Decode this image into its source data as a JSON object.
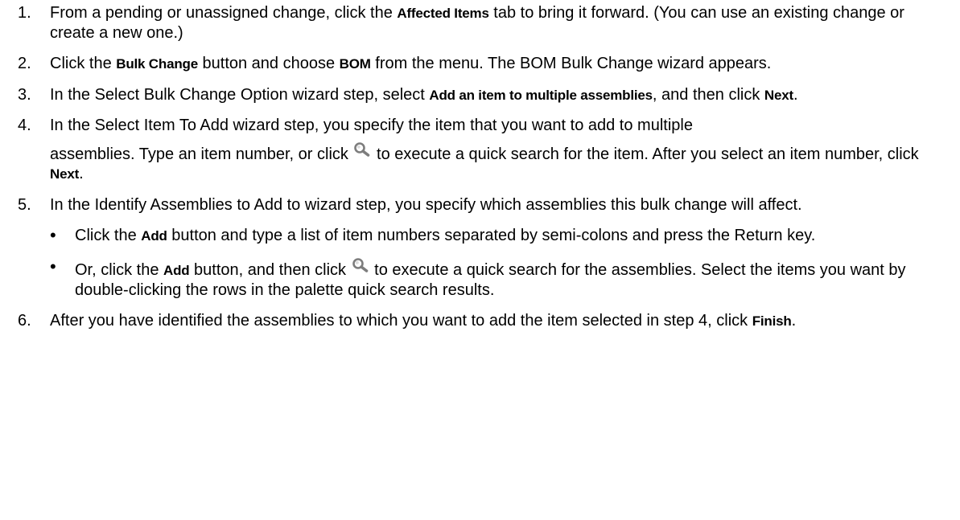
{
  "steps": [
    {
      "num": "1.",
      "a": "From a pending or unassigned change, click the ",
      "b1": "Affected Items",
      "c": " tab to bring it forward. (You can use an existing change or create a new one.)"
    },
    {
      "num": "2.",
      "a": "Click the ",
      "b1": "Bulk Change",
      "c": " button and choose ",
      "b2": "BOM",
      "d": " from the menu. The BOM Bulk Change wizard appears."
    },
    {
      "num": "3.",
      "a": "In the Select Bulk Change Option wizard step, select ",
      "b1": "Add an item to multiple assemblies",
      "c": ", and then click ",
      "b2": "Next",
      "d": "."
    },
    {
      "num": "4.",
      "line1": "In the Select Item To Add wizard step, you specify the item that you want to add to multiple",
      "a": "assemblies. Type an item number, or click ",
      "c": " to execute a quick search for the item. After you select an item number, click ",
      "b1": "Next",
      "d": "."
    },
    {
      "num": "5.",
      "intro": "In the Identify Assemblies to Add to wizard step, you specify which assemblies this bulk change will affect.",
      "bullets": [
        {
          "dot": "•",
          "a": "Click the ",
          "b1": "Add",
          "c": " button and type a list of item numbers separated by semi-colons and press the Return key."
        },
        {
          "dot": "•",
          "a": "Or, click the ",
          "b1": "Add",
          "c": " button, and then click ",
          "d": " to execute a quick search for the assemblies. Select the items you want by double-clicking the rows in the palette quick search results."
        }
      ]
    },
    {
      "num": "6.",
      "a": "After you have identified the assemblies to which you want to add the item selected in step 4, click ",
      "b1": "Finish",
      "d": "."
    }
  ],
  "icons": {
    "search": "search-icon",
    "search_color": "#8a8a8a"
  }
}
